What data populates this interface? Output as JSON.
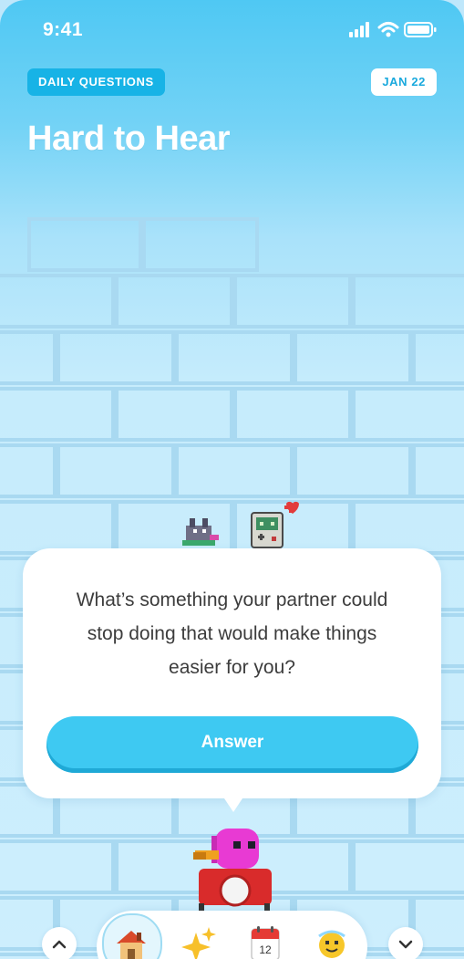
{
  "status_bar": {
    "time": "9:41"
  },
  "header": {
    "category_badge": "DAILY QUESTIONS",
    "date_badge": "JAN 22",
    "title": "Hard to Hear"
  },
  "question_card": {
    "question": "What’s something your partner could stop doing that would make things easier for you?",
    "answer_label": "Answer"
  },
  "bottom_nav": {
    "calendar_day": "12",
    "items": [
      "up-arrow",
      "home-icon",
      "sparkles-icon",
      "calendar-icon",
      "smiley-icon",
      "down-arrow"
    ]
  },
  "colors": {
    "accent": "#3ec9f2",
    "badge_blue": "#17b3e6",
    "sky_top": "#4fc8f3",
    "card": "#ffffff"
  }
}
